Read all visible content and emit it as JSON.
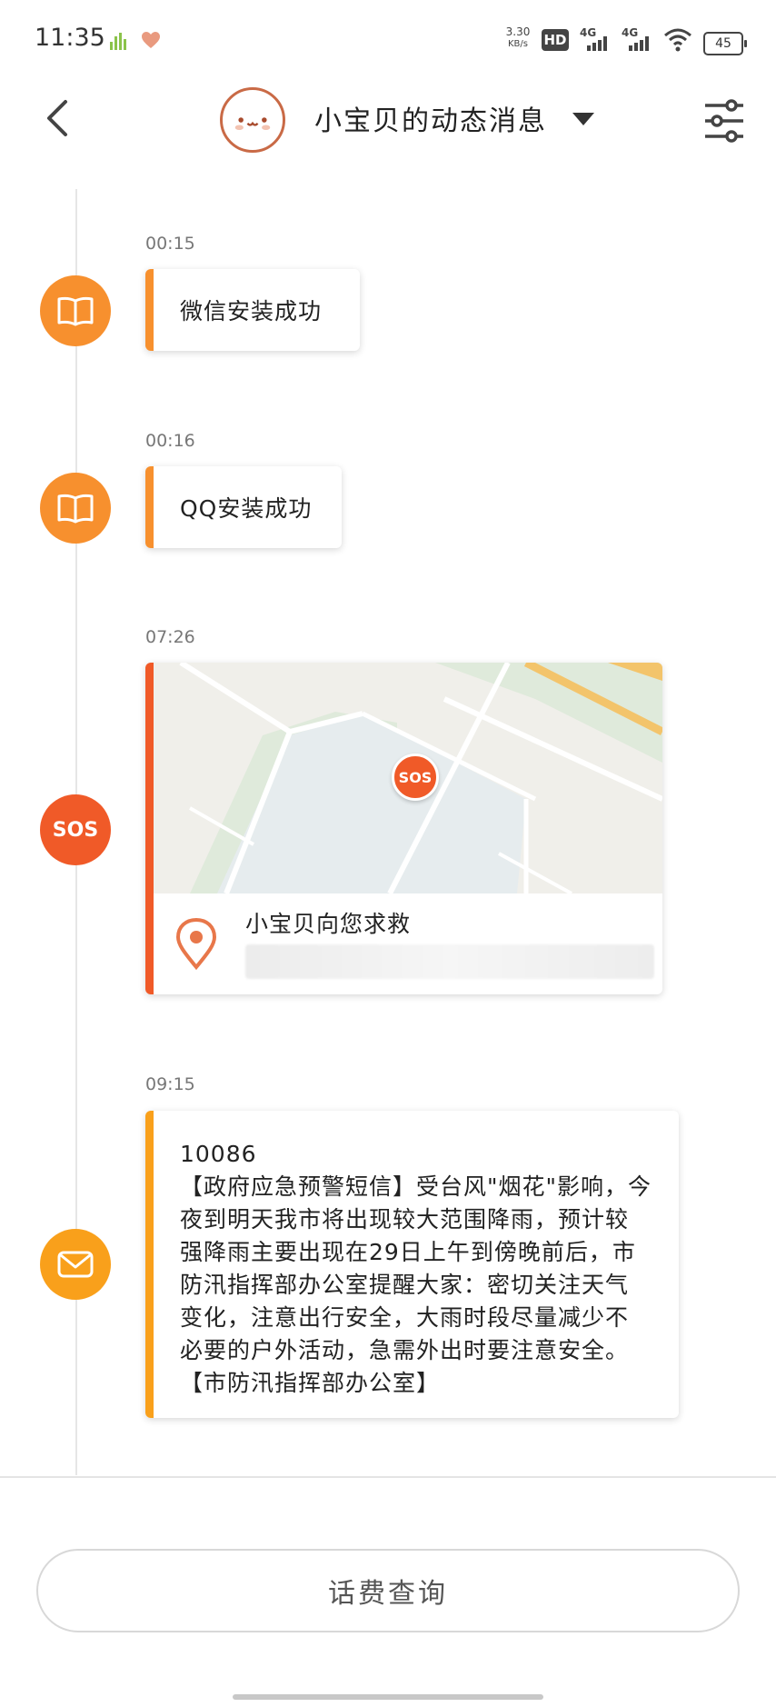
{
  "status_bar": {
    "time": "11:35",
    "net_speed_value": "3.30",
    "net_speed_unit": "KB/s",
    "hd_label": "HD",
    "sim1_label": "4G",
    "sim2_label": "4G",
    "battery": "45",
    "icons": [
      "activity-chart-icon",
      "heart-icon",
      "wifi-icon",
      "battery-icon"
    ]
  },
  "header": {
    "title": "小宝贝的动态消息",
    "icons": [
      "back-arrow-icon",
      "avatar-face-icon",
      "chevron-down-icon",
      "filter-sliders-icon"
    ]
  },
  "colors": {
    "accent_orange": "#f7902e",
    "sos_red": "#f05a28",
    "sms_yellow": "#f9a01b"
  },
  "timeline": {
    "items": [
      {
        "time": "00:15",
        "text": "微信安装成功",
        "icon": "book-icon"
      },
      {
        "time": "00:16",
        "text": "QQ安装成功",
        "icon": "book-icon"
      },
      {
        "time": "07:26",
        "node_label": "SOS",
        "map_marker": "SOS",
        "text": "小宝贝向您求救",
        "icon": "location-pin-icon"
      },
      {
        "time": "09:15",
        "icon": "mail-icon",
        "sender": "10086",
        "body": "【政府应急预警短信】受台风\"烟花\"影响，今夜到明天我市将出现较大范围降雨，预计较强降雨主要出现在29日上午到傍晚前后，市防汛指挥部办公室提醒大家：密切关注天气变化，注意出行安全，大雨时段尽量减少不必要的户外活动，急需外出时要注意安全。【市防汛指挥部办公室】"
      }
    ]
  },
  "footer": {
    "query_button": "话费查询"
  }
}
